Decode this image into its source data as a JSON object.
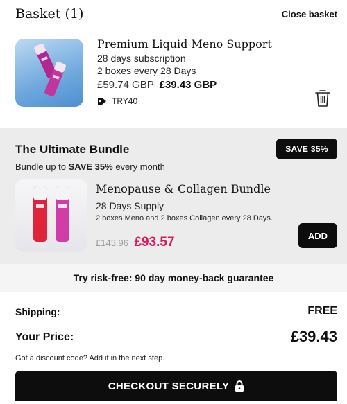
{
  "header": {
    "title": "Basket (1)",
    "close_label": "Close basket"
  },
  "cart_item": {
    "name": "Premium Liquid Meno Support",
    "subscription": "28 days subscription",
    "frequency": "2 boxes every 28 Days",
    "old_price": "£59.74 GBP",
    "new_price": "£39.43 GBP",
    "coupon_code": "TRY40",
    "coupon_icon": "tag-icon",
    "remove_icon": "trash-icon"
  },
  "upsell": {
    "title": "The Ultimate Bundle",
    "subtitle_prefix": "Bundle up to ",
    "subtitle_bold": "SAVE 35%",
    "subtitle_suffix": " every month",
    "badge": "SAVE 35%",
    "product_name": "Menopause & Collagen Bundle",
    "supply": "28 Days Supply",
    "description": "2 boxes Meno and 2 boxes Collagen every 28 Days.",
    "old_price": "£143.96",
    "new_price": "£93.57",
    "add_label": "ADD"
  },
  "guarantee": {
    "text": "Try risk-free: 90 day money-back guarantee"
  },
  "summary": {
    "shipping_label": "Shipping:",
    "shipping_value": "FREE",
    "price_label": "Your Price:",
    "price_value": "£39.43",
    "discount_hint": "Got a discount code? Add it in the next step."
  },
  "checkout": {
    "label": "CHECKOUT SECURELY",
    "icon": "lock-icon"
  },
  "colors": {
    "accent_price": "#d81b60",
    "button_bg": "#0d0d0d",
    "panel_bg": "#ececec",
    "guarantee_bg": "#f5f5f5"
  }
}
